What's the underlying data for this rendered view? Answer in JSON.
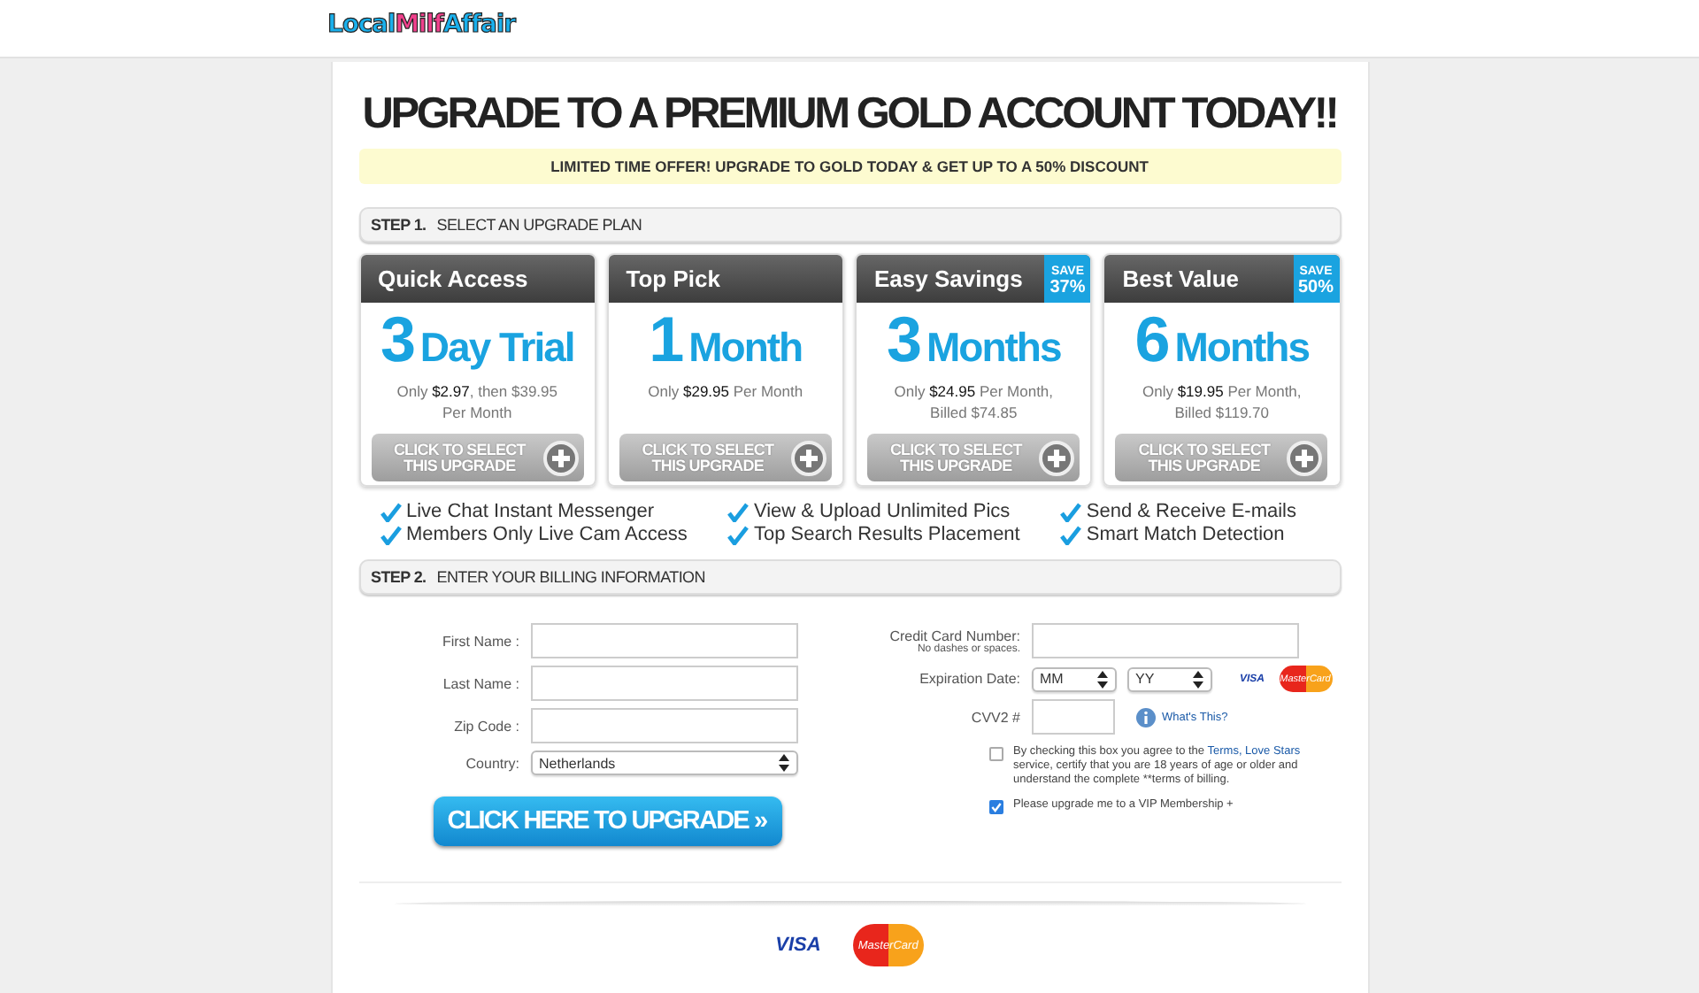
{
  "logo": [
    {
      "text": "Local",
      "color": "#1ab0ec"
    },
    {
      "text": "Milf",
      "color": "#f0418c"
    },
    {
      "text": "Affair",
      "color": "#1ab0ec"
    }
  ],
  "headline": "UPGRADE TO A PREMIUM GOLD ACCOUNT TODAY!!",
  "offer_banner": "LIMITED TIME OFFER! UPGRADE TO GOLD TODAY & GET UP TO A 50% DISCOUNT",
  "step1": {
    "number": "STEP 1.",
    "title": "SELECT AN UPGRADE PLAN"
  },
  "plans": [
    {
      "title": "Quick Access",
      "count": "3",
      "unit": "Day Trial",
      "price": "Only **$2.97**, then $39.95 Per Month",
      "button": "CLICK TO SELECT THIS UPGRADE"
    },
    {
      "title": "Top Pick",
      "count": "1",
      "unit": "Month",
      "price": "Only **$29.95** Per Month",
      "button": "CLICK TO SELECT THIS UPGRADE"
    },
    {
      "title": "Easy Savings",
      "count": "3",
      "unit": "Months",
      "price": "Only **$24.95** Per Month, Billed $74.85",
      "button": "CLICK TO SELECT THIS UPGRADE",
      "save": [
        "SAVE",
        "37%"
      ]
    },
    {
      "title": "Best Value",
      "count": "6",
      "unit": "Months",
      "price": "Only **$19.95** Per Month, Billed $119.70",
      "button": "CLICK TO SELECT THIS UPGRADE",
      "save": [
        "SAVE",
        "50%"
      ]
    }
  ],
  "features": [
    [
      "Live Chat Instant Messenger",
      "Members Only Live Cam Access"
    ],
    [
      "View & Upload Unlimited Pics",
      "Top Search Results Placement"
    ],
    [
      "Send & Receive E-mails",
      "Smart Match Detection"
    ]
  ],
  "step2": {
    "number": "STEP 2.",
    "title": "ENTER YOUR BILLING INFORMATION"
  },
  "billing_fields": [
    {
      "label": "First Name :",
      "kind": "text"
    },
    {
      "label": "Last Name :",
      "kind": "text"
    },
    {
      "label": "Zip Code :",
      "kind": "text"
    },
    {
      "label": "Country:",
      "kind": "select",
      "value": "Netherlands"
    }
  ],
  "upgrade_button": "CLICK HERE TO UPGRADE »",
  "card_fields": {
    "number_label": "Credit Card Number:",
    "number_hint": "No dashes or spaces.",
    "expiry_label": "Expiration Date:",
    "month": "MM",
    "year": "YY",
    "cvv_label": "CVV2 #",
    "cvv_help": "What's This?"
  },
  "small_card_logos": {
    "visa": "VISA",
    "mastercard": "MasterCard"
  },
  "agreements": [
    {
      "checked": false,
      "before": "By checking this box you agree to the",
      "link": "Terms, Love Stars",
      "after": "service, certify that you are 18 years of age or older and understand the complete **terms of billing."
    },
    {
      "checked": true,
      "before": "Please upgrade me to a VIP Membership +"
    }
  ],
  "footer_card_logos": {
    "visa": "VISA",
    "mastercard": "MasterCard"
  }
}
